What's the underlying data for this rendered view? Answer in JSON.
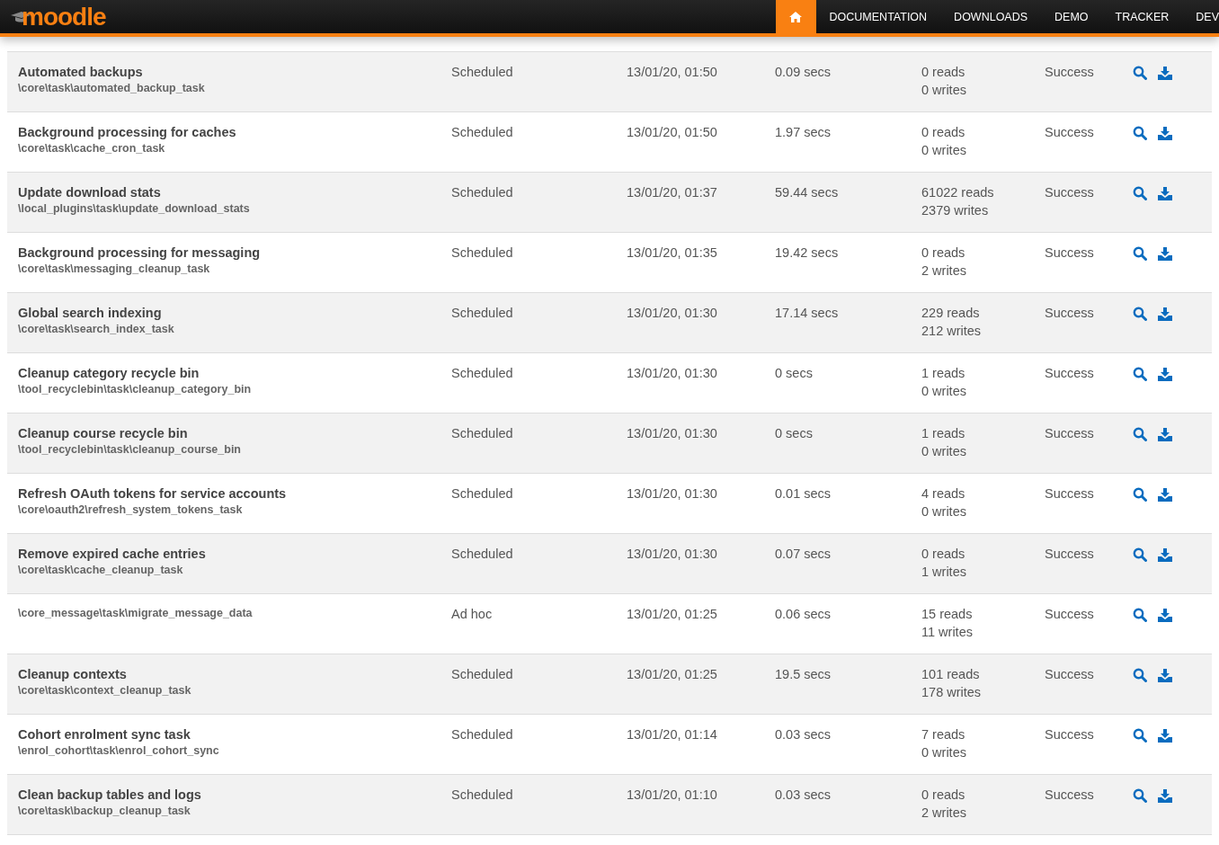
{
  "logo": {
    "text": "moodle"
  },
  "nav": [
    {
      "kind": "home",
      "selected": true
    },
    {
      "kind": "link",
      "label": "DOCUMENTATION",
      "selected": false
    },
    {
      "kind": "link",
      "label": "DOWNLOADS",
      "selected": false
    },
    {
      "kind": "link",
      "label": "DEMO",
      "selected": false
    },
    {
      "kind": "link",
      "label": "TRACKER",
      "selected": false
    },
    {
      "kind": "link",
      "label": "DEV",
      "selected": false
    }
  ],
  "tasks": [
    {
      "name": "Automated backups",
      "classname": "\\core\\task\\automated_backup_task",
      "type": "Scheduled",
      "time": "13/01/20, 01:50",
      "duration": "0.09 secs",
      "reads": "0 reads",
      "writes": "0 writes",
      "result": "Success"
    },
    {
      "name": "Background processing for caches",
      "classname": "\\core\\task\\cache_cron_task",
      "type": "Scheduled",
      "time": "13/01/20, 01:50",
      "duration": "1.97 secs",
      "reads": "0 reads",
      "writes": "0 writes",
      "result": "Success"
    },
    {
      "name": "Update download stats",
      "classname": "\\local_plugins\\task\\update_download_stats",
      "type": "Scheduled",
      "time": "13/01/20, 01:37",
      "duration": "59.44 secs",
      "reads": "61022 reads",
      "writes": "2379 writes",
      "result": "Success"
    },
    {
      "name": "Background processing for messaging",
      "classname": "\\core\\task\\messaging_cleanup_task",
      "type": "Scheduled",
      "time": "13/01/20, 01:35",
      "duration": "19.42 secs",
      "reads": "0 reads",
      "writes": "2 writes",
      "result": "Success"
    },
    {
      "name": "Global search indexing",
      "classname": "\\core\\task\\search_index_task",
      "type": "Scheduled",
      "time": "13/01/20, 01:30",
      "duration": "17.14 secs",
      "reads": "229 reads",
      "writes": "212 writes",
      "result": "Success"
    },
    {
      "name": "Cleanup category recycle bin",
      "classname": "\\tool_recyclebin\\task\\cleanup_category_bin",
      "type": "Scheduled",
      "time": "13/01/20, 01:30",
      "duration": "0 secs",
      "reads": "1 reads",
      "writes": "0 writes",
      "result": "Success"
    },
    {
      "name": "Cleanup course recycle bin",
      "classname": "\\tool_recyclebin\\task\\cleanup_course_bin",
      "type": "Scheduled",
      "time": "13/01/20, 01:30",
      "duration": "0 secs",
      "reads": "1 reads",
      "writes": "0 writes",
      "result": "Success"
    },
    {
      "name": "Refresh OAuth tokens for service accounts",
      "classname": "\\core\\oauth2\\refresh_system_tokens_task",
      "type": "Scheduled",
      "time": "13/01/20, 01:30",
      "duration": "0.01 secs",
      "reads": "4 reads",
      "writes": "0 writes",
      "result": "Success"
    },
    {
      "name": "Remove expired cache entries",
      "classname": "\\core\\task\\cache_cleanup_task",
      "type": "Scheduled",
      "time": "13/01/20, 01:30",
      "duration": "0.07 secs",
      "reads": "0 reads",
      "writes": "1 writes",
      "result": "Success"
    },
    {
      "classname": "\\core_message\\task\\migrate_message_data",
      "type": "Ad hoc",
      "time": "13/01/20, 01:25",
      "duration": "0.06 secs",
      "reads": "15 reads",
      "writes": "11 writes",
      "result": "Success"
    },
    {
      "name": "Cleanup contexts",
      "classname": "\\core\\task\\context_cleanup_task",
      "type": "Scheduled",
      "time": "13/01/20, 01:25",
      "duration": "19.5 secs",
      "reads": "101 reads",
      "writes": "178 writes",
      "result": "Success"
    },
    {
      "name": "Cohort enrolment sync task",
      "classname": "\\enrol_cohort\\task\\enrol_cohort_sync",
      "type": "Scheduled",
      "time": "13/01/20, 01:14",
      "duration": "0.03 secs",
      "reads": "7 reads",
      "writes": "0 writes",
      "result": "Success"
    },
    {
      "name": "Clean backup tables and logs",
      "classname": "\\core\\task\\backup_cleanup_task",
      "type": "Scheduled",
      "time": "13/01/20, 01:10",
      "duration": "0.03 secs",
      "reads": "0 reads",
      "writes": "2 writes",
      "result": "Success"
    }
  ]
}
